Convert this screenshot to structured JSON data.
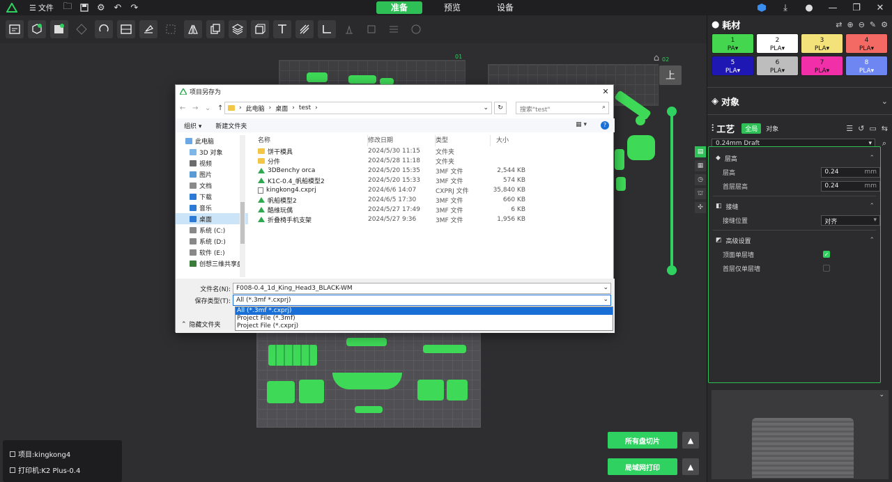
{
  "topbar": {
    "file_label": "文件",
    "tabs": [
      {
        "label": "准备",
        "active": true
      },
      {
        "label": "预览",
        "active": false
      },
      {
        "label": "设备",
        "active": false
      }
    ]
  },
  "viewport": {
    "plate_labels": [
      "01",
      "02"
    ],
    "view_cube_label": "上",
    "project_label": "项目:kingkong4",
    "printer_label": "打印机:K2 Plus-0.4",
    "slice_all_label": "所有盘切片",
    "lan_print_label": "局域网打印"
  },
  "right_panel": {
    "filament_title": "耗材",
    "filaments": [
      {
        "num": "1",
        "type": "PA",
        "color": "#45d64f",
        "text": "#111"
      },
      {
        "num": "2",
        "type": "PLA",
        "color": "#ffffff",
        "text": "#111"
      },
      {
        "num": "3",
        "type": "PLA",
        "color": "#f3e17a",
        "text": "#111"
      },
      {
        "num": "4",
        "type": "PLA",
        "color": "#f26a63",
        "text": "#111"
      },
      {
        "num": "5",
        "type": "PLA",
        "color": "#1e17b3",
        "text": "#fff"
      },
      {
        "num": "6",
        "type": "PLA",
        "color": "#bdbdbd",
        "text": "#111"
      },
      {
        "num": "7",
        "type": "PLA",
        "color": "#f02fa8",
        "text": "#111"
      },
      {
        "num": "8",
        "type": "PLA",
        "color": "#6d86f2",
        "text": "#fff"
      }
    ],
    "objects_title": "对象",
    "process_title": "工艺",
    "process_tabs": [
      "全局",
      "对象"
    ],
    "preset": "0.24mm Draft",
    "groups": {
      "layer_height": "层高",
      "seam": "接缝",
      "advanced": "高级设置"
    },
    "layer_height_label": "层高",
    "layer_height_value": "0.24",
    "first_layer_label": "首层层高",
    "first_layer_value": "0.24",
    "unit": "mm",
    "seam_position_label": "接缝位置",
    "seam_position_value": "对齐",
    "top_single_wall_label": "顶面单层墙",
    "first_single_wall_label": "首层仅单层墙"
  },
  "dialog": {
    "title": "项目另存为",
    "breadcrumb": [
      "此电脑",
      "桌面",
      "test"
    ],
    "search_placeholder": "搜索\"test\"",
    "organize": "组织 ▾",
    "new_folder": "新建文件夹",
    "nav": [
      {
        "label": "此电脑",
        "root": true,
        "color": "#6aa8e8"
      },
      {
        "label": "3D 对象",
        "color": "#7fb6e8"
      },
      {
        "label": "视频",
        "color": "#6b6b6b"
      },
      {
        "label": "图片",
        "color": "#5b9bd5"
      },
      {
        "label": "文档",
        "color": "#8a8a8a"
      },
      {
        "label": "下载",
        "color": "#2b7bd6"
      },
      {
        "label": "音乐",
        "color": "#2b7bd6"
      },
      {
        "label": "桌面",
        "color": "#2b7bd6",
        "selected": true
      },
      {
        "label": "系统 (C:)",
        "color": "#888"
      },
      {
        "label": "系统 (D:)",
        "color": "#888"
      },
      {
        "label": "软件 (E:)",
        "color": "#888"
      },
      {
        "label": "创想三维共享盘",
        "color": "#3a7d3a"
      }
    ],
    "columns": {
      "name": "名称",
      "date": "修改日期",
      "type": "类型",
      "size": "大小"
    },
    "files": [
      {
        "name": "饼干模具",
        "date": "2024/5/30 11:15",
        "type": "文件夹",
        "size": "",
        "icon": "folder"
      },
      {
        "name": "分件",
        "date": "2024/5/28 11:18",
        "type": "文件夹",
        "size": "",
        "icon": "folder"
      },
      {
        "name": "3DBenchy orca",
        "date": "2024/5/20 15:35",
        "type": "3MF 文件",
        "size": "2,544 KB",
        "icon": "3mf"
      },
      {
        "name": "K1C-0.4_帆船模型2",
        "date": "2024/5/20 15:33",
        "type": "3MF 文件",
        "size": "574 KB",
        "icon": "3mf"
      },
      {
        "name": "kingkong4.cxprj",
        "date": "2024/6/6 14:07",
        "type": "CXPRJ 文件",
        "size": "35,840 KB",
        "icon": "doc"
      },
      {
        "name": "帆船模型2",
        "date": "2024/6/5 17:30",
        "type": "3MF 文件",
        "size": "660 KB",
        "icon": "3mf"
      },
      {
        "name": "酷维玩偶",
        "date": "2024/5/27 17:49",
        "type": "3MF 文件",
        "size": "6 KB",
        "icon": "3mf"
      },
      {
        "name": "折叠椅手机支架",
        "date": "2024/5/27 9:36",
        "type": "3MF 文件",
        "size": "1,956 KB",
        "icon": "3mf"
      }
    ],
    "filename_label": "文件名(N):",
    "filename_value": "F008-0.4_1d_King_Head3_BLACK-WM",
    "filetype_label": "保存类型(T):",
    "filetype_value": "All (*.3mf *.cxprj)",
    "filetype_options": [
      "All (*.3mf *.cxprj)",
      "Project File (*.3mf)",
      "Project File (*.cxprj)"
    ],
    "hide_folders": "隐藏文件夹"
  }
}
